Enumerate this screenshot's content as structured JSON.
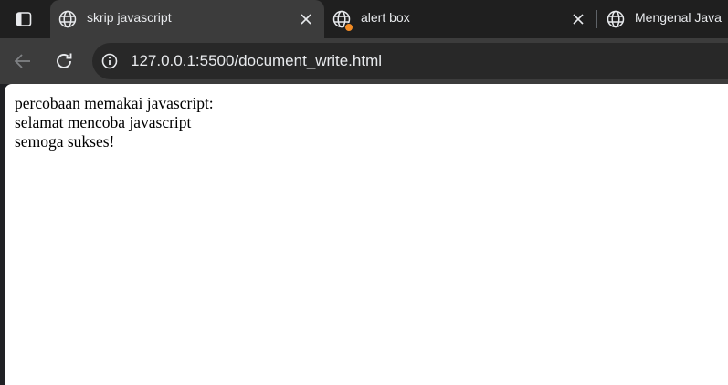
{
  "tabs": [
    {
      "title": "skrip javascript",
      "active": true,
      "icon": "globe-icon"
    },
    {
      "title": "alert box",
      "active": false,
      "icon": "globe-icon",
      "has_notification": true
    },
    {
      "title": "Mengenal Java",
      "active": false,
      "icon": "globe-icon"
    }
  ],
  "toolbar": {
    "url": "127.0.0.1:5500/document_write.html"
  },
  "page": {
    "lines": [
      "percobaan memakai javascript:",
      "selamat mencoba javascript",
      "semoga sukses!"
    ]
  },
  "colors": {
    "tabstrip_bg": "#1f1f1f",
    "active_tab_bg": "#3c3c3c",
    "omnibox_bg": "#282828",
    "notification_dot": "#f28b24",
    "page_bg": "#ffffff"
  }
}
